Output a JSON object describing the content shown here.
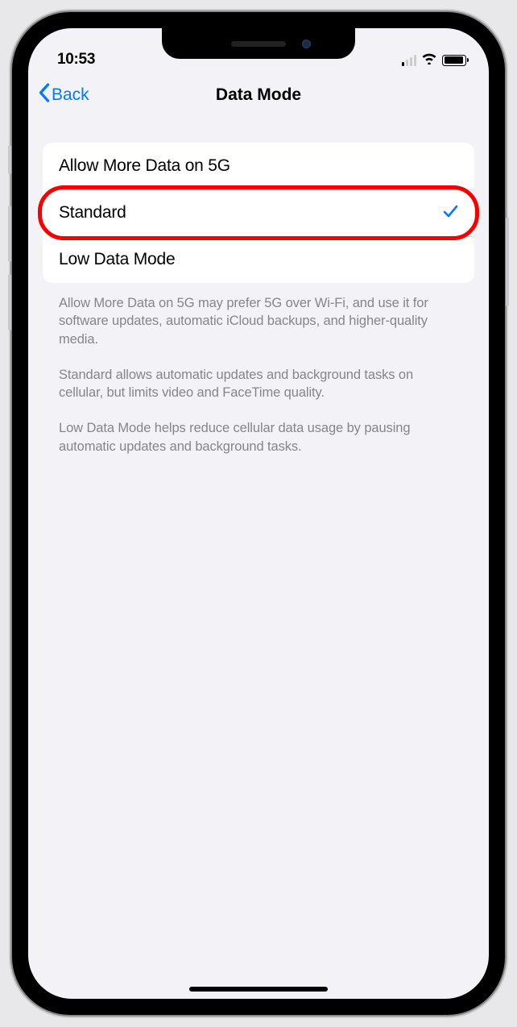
{
  "status": {
    "time": "10:53"
  },
  "nav": {
    "back_label": "Back",
    "title": "Data Mode"
  },
  "options": [
    {
      "label": "Allow More Data on 5G",
      "selected": false
    },
    {
      "label": "Standard",
      "selected": true
    },
    {
      "label": "Low Data Mode",
      "selected": false
    }
  ],
  "footer": {
    "p1": "Allow More Data on 5G may prefer 5G over Wi-Fi, and use it for software updates, automatic iCloud backups, and higher-quality media.",
    "p2": "Standard allows automatic updates and background tasks on cellular, but limits video and FaceTime quality.",
    "p3": "Low Data Mode helps reduce cellular data usage by pausing automatic updates and background tasks."
  },
  "highlight_index": 1,
  "colors": {
    "accent": "#007aff",
    "highlight": "#f80000"
  }
}
